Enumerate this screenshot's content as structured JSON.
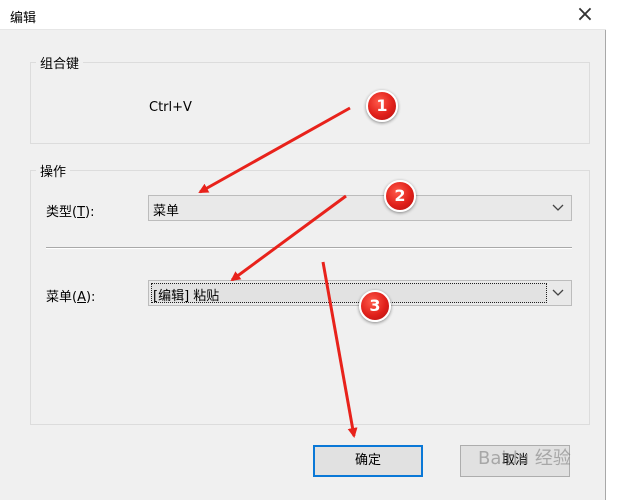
{
  "dialog": {
    "title": "编辑",
    "close_glyph": "×"
  },
  "shortcut_group": {
    "label": "组合键",
    "value": "Ctrl+V"
  },
  "action_group": {
    "label": "操作",
    "type_label": "类型(",
    "type_key": "T",
    "type_suffix": "):",
    "type_value": "菜单",
    "menu_label": "菜单(",
    "menu_key": "A",
    "menu_suffix": "):",
    "menu_value": "[编辑] 粘贴"
  },
  "buttons": {
    "ok_label": "确定",
    "cancel_label": "取消"
  },
  "annotations": {
    "markers": [
      "1",
      "2",
      "3"
    ],
    "color": "#e8221b"
  },
  "watermark": "Baidu 经验"
}
